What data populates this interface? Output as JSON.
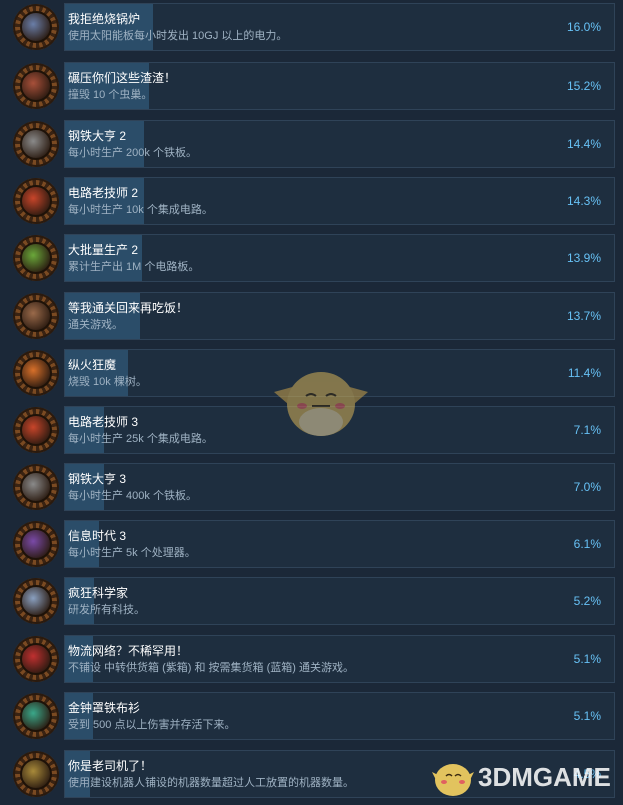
{
  "achievements": [
    {
      "title": "我拒绝烧锅炉",
      "desc": "使用太阳能板每小时发出 10GJ 以上的电力。",
      "percent": "16.0%",
      "icon": "solar-panel-icon",
      "color": "#6a7ea8"
    },
    {
      "title": "碾压你们这些渣渣！",
      "desc": "撞毁 10 个虫巢。",
      "percent": "15.2%",
      "icon": "crushed-nest-icon",
      "color": "#a8503a"
    },
    {
      "title": "钢铁大亨 2",
      "desc": "每小时生产 200k 个铁板。",
      "percent": "14.4%",
      "icon": "iron-plate-icon",
      "color": "#8a8a8a"
    },
    {
      "title": "电路老技师 2",
      "desc": "每小时生产 10k 个集成电路。",
      "percent": "14.3%",
      "icon": "circuit-icon",
      "color": "#c8452a"
    },
    {
      "title": "大批量生产 2",
      "desc": "累计生产出 1M 个电路板。",
      "percent": "13.9%",
      "icon": "green-circuit-icon",
      "color": "#6aa83a"
    },
    {
      "title": "等我通关回来再吃饭！",
      "desc": "通关游戏。",
      "percent": "13.7%",
      "icon": "rocket-icon",
      "color": "#9a6a4a"
    },
    {
      "title": "纵火狂魔",
      "desc": "烧毁 10k 棵树。",
      "percent": "11.4%",
      "icon": "fire-icon",
      "color": "#d8702a"
    },
    {
      "title": "电路老技师 3",
      "desc": "每小时生产 25k 个集成电路。",
      "percent": "7.1%",
      "icon": "circuit-icon",
      "color": "#c8452a"
    },
    {
      "title": "钢铁大亨 3",
      "desc": "每小时生产 400k 个铁板。",
      "percent": "7.0%",
      "icon": "iron-plate-icon",
      "color": "#8a8a8a"
    },
    {
      "title": "信息时代 3",
      "desc": "每小时生产 5k 个处理器。",
      "percent": "6.1%",
      "icon": "processor-icon",
      "color": "#7a4aa8"
    },
    {
      "title": "疯狂科学家",
      "desc": "研发所有科技。",
      "percent": "5.2%",
      "icon": "science-icon",
      "color": "#8aa0c0"
    },
    {
      "title": "物流网络？不稀罕用！",
      "desc": "不铺设 中转供货箱 (紫箱) 和 按需集货箱 (蓝箱) 通关游戏。",
      "percent": "5.1%",
      "icon": "no-logistics-icon",
      "color": "#c03030"
    },
    {
      "title": "金钟罩铁布衫",
      "desc": "受到 500 点以上伤害并存活下来。",
      "percent": "5.1%",
      "icon": "armor-icon",
      "color": "#3aa88a"
    },
    {
      "title": "你是老司机了！",
      "desc": "使用建设机器人铺设的机器数量超过人工放置的机器数量。",
      "percent": "4.5%",
      "icon": "robot-icon",
      "color": "#a88a3a"
    }
  ],
  "watermark": {
    "text": "3DMGAME"
  }
}
